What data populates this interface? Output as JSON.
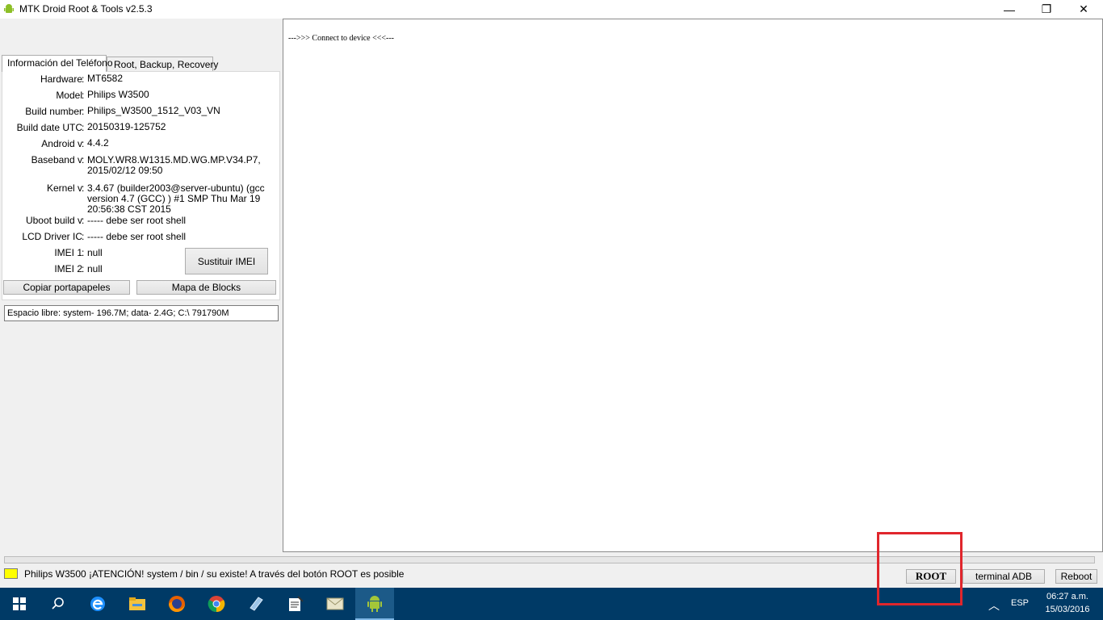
{
  "window": {
    "title": "MTK Droid Root & Tools v2.5.3",
    "minimize": "—",
    "maximize": "❐",
    "close": "✕"
  },
  "tabs": [
    {
      "label": "Información del Teléfono",
      "active": true
    },
    {
      "label": "Root, Backup, Recovery",
      "active": false
    }
  ],
  "phone_info": {
    "hardware": {
      "label": "Hardware",
      "value": "MT6582"
    },
    "model": {
      "label": "Model",
      "value": "Philips W3500"
    },
    "build_number": {
      "label": "Build number",
      "value": "Philips_W3500_1512_V03_VN"
    },
    "build_date": {
      "label": "Build date UTC",
      "value": "20150319-125752"
    },
    "android": {
      "label": "Android  v",
      "value": "4.4.2"
    },
    "baseband": {
      "label": "Baseband v",
      "value": "MOLY.WR8.W1315.MD.WG.MP.V34.P7, 2015/02/12 09:50"
    },
    "kernel": {
      "label": "Kernel v",
      "value": "3.4.67 (builder2003@server-ubuntu) (gcc version 4.7 (GCC) ) #1 SMP  Thu Mar 19 20:56:38 CST 2015"
    },
    "uboot": {
      "label": "Uboot build v",
      "value": "----- debe ser  root shell"
    },
    "lcd": {
      "label": "LCD Driver IC",
      "value": "----- debe ser  root shell"
    },
    "imei1": {
      "label": "IMEI 1",
      "value": "null"
    },
    "imei2": {
      "label": "IMEI 2",
      "value": "null"
    },
    "separator": ":"
  },
  "buttons": {
    "replace_imei": "Sustituir IMEI",
    "copy_clipboard": "Copiar portapapeles",
    "block_map": "Mapa de Blocks",
    "root": "ROOT",
    "adb_terminal": "terminal ADB",
    "reboot": "Reboot"
  },
  "free_space": "Espacio libre: system- 196.7M; data- 2.4G;  C:\\ 791790M",
  "log": "--->>> Connect to device <<<---",
  "status": {
    "text": "Philips W3500 ¡ATENCIÓN! system / bin / su existe! A través del botón ROOT es posible",
    "indicator_color": "#ffff00"
  },
  "colors": {
    "highlight": "#e0262c",
    "taskbar": "#003a66"
  },
  "taskbar": {
    "icons": [
      "windows-start-icon",
      "search-icon",
      "edge-icon",
      "file-explorer-icon",
      "firefox-icon",
      "chrome-icon",
      "app-icon",
      "notepad-icon",
      "mail-icon",
      "android-tool-icon"
    ],
    "language": "ESP",
    "time": "06:27 a.m.",
    "date": "15/03/2016"
  }
}
